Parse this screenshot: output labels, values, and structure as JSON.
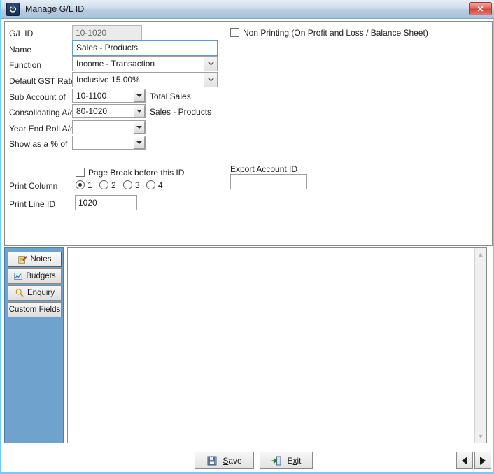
{
  "window": {
    "title": "Manage G/L ID",
    "app_icon": "power-icon",
    "close_label": "✕",
    "accent_border": "#6dcff6",
    "titlebar_color": "#b9cce0"
  },
  "form": {
    "gl_id": {
      "label": "G/L ID",
      "value": "10-1020",
      "readonly": true
    },
    "name": {
      "label": "Name",
      "value": "Sales - Products",
      "focused": true
    },
    "function": {
      "label": "Function",
      "value": "Income - Transaction"
    },
    "default_gst_rate": {
      "label": "Default GST Rate",
      "value": "Inclusive 15.00%"
    },
    "sub_account_of": {
      "label": "Sub Account of",
      "value": "10-1100",
      "description": "Total Sales"
    },
    "consolidating_ac": {
      "label": "Consolidating A/c",
      "value": "80-1020",
      "description": "Sales - Products"
    },
    "year_end_roll_ac": {
      "label": "Year End Roll A/c",
      "value": "",
      "description": ""
    },
    "show_as_a_percent_of": {
      "label": "Show as a % of",
      "value": "",
      "description": ""
    },
    "non_printing": {
      "label": "Non Printing (On Profit and Loss / Balance Sheet)",
      "checked": false
    },
    "page_break": {
      "label": "Page Break before this ID",
      "checked": false
    },
    "print_column": {
      "label": "Print Column",
      "options": [
        "1",
        "2",
        "3",
        "4"
      ],
      "selected": "1"
    },
    "print_line_id": {
      "label": "Print Line ID",
      "value": "1020"
    },
    "export_account_id": {
      "label": "Export Account ID",
      "value": ""
    }
  },
  "side_tabs": [
    {
      "label": "Notes",
      "icon": "notepad-icon",
      "active": true
    },
    {
      "label": "Budgets",
      "icon": "chart-icon",
      "active": false
    },
    {
      "label": "Enquiry",
      "icon": "magnifier-icon",
      "active": false
    },
    {
      "label": "Custom Fields",
      "icon": "",
      "active": false
    }
  ],
  "notes": {
    "value": "",
    "scrollbar": {
      "up": "▲",
      "down": "▼"
    }
  },
  "footer": {
    "save": {
      "label": "Save",
      "accel": "S",
      "icon": "floppy-disk-icon"
    },
    "exit": {
      "label": "Exit",
      "accel": "x",
      "icon": "exit-door-icon"
    },
    "prev": {
      "label": "◀",
      "icon": "arrow-left-icon"
    },
    "next": {
      "label": "▶",
      "icon": "arrow-right-icon"
    }
  }
}
